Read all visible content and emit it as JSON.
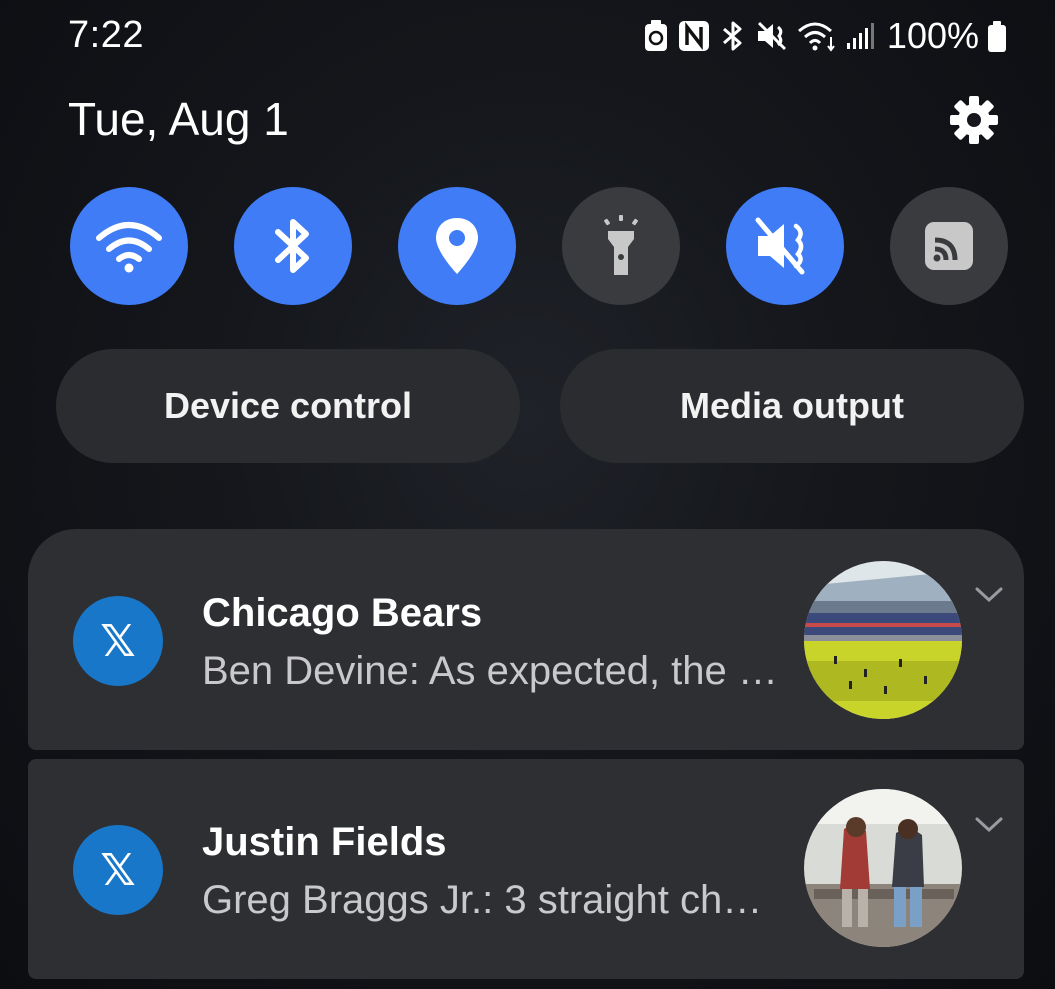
{
  "status_bar": {
    "time": "7:22",
    "battery_percent": "100%",
    "icons": [
      "battery-saver-icon",
      "nfc-icon",
      "bluetooth-icon",
      "mute-icon",
      "wifi-icon",
      "signal-icon",
      "battery-icon"
    ]
  },
  "header": {
    "date": "Tue, Aug 1",
    "settings_icon": "gear-icon"
  },
  "quick_toggles": [
    {
      "name": "wifi",
      "icon": "wifi-icon",
      "state": "on"
    },
    {
      "name": "bluetooth",
      "icon": "bluetooth-icon",
      "state": "on"
    },
    {
      "name": "location",
      "icon": "location-pin-icon",
      "state": "on"
    },
    {
      "name": "flashlight",
      "icon": "flashlight-icon",
      "state": "off"
    },
    {
      "name": "mute",
      "icon": "mute-icon",
      "state": "on"
    },
    {
      "name": "cast",
      "icon": "cast-icon",
      "state": "off"
    }
  ],
  "pills": {
    "device_control": "Device control",
    "media_output": "Media output"
  },
  "notifications": [
    {
      "app_icon": "x-logo-icon",
      "app_glyph": "𝕏",
      "title": "Chicago Bears",
      "body": "Ben Devine: As expected, the …"
    },
    {
      "app_icon": "x-logo-icon",
      "app_glyph": "𝕏",
      "title": "Justin Fields",
      "body": "Greg Braggs Jr.: 3 straight ch…"
    }
  ],
  "colors": {
    "accent_on": "#3f7cf5",
    "toggle_off": "#3a3b3f",
    "card": "#2e2f33",
    "x_blue": "#1877c9"
  }
}
